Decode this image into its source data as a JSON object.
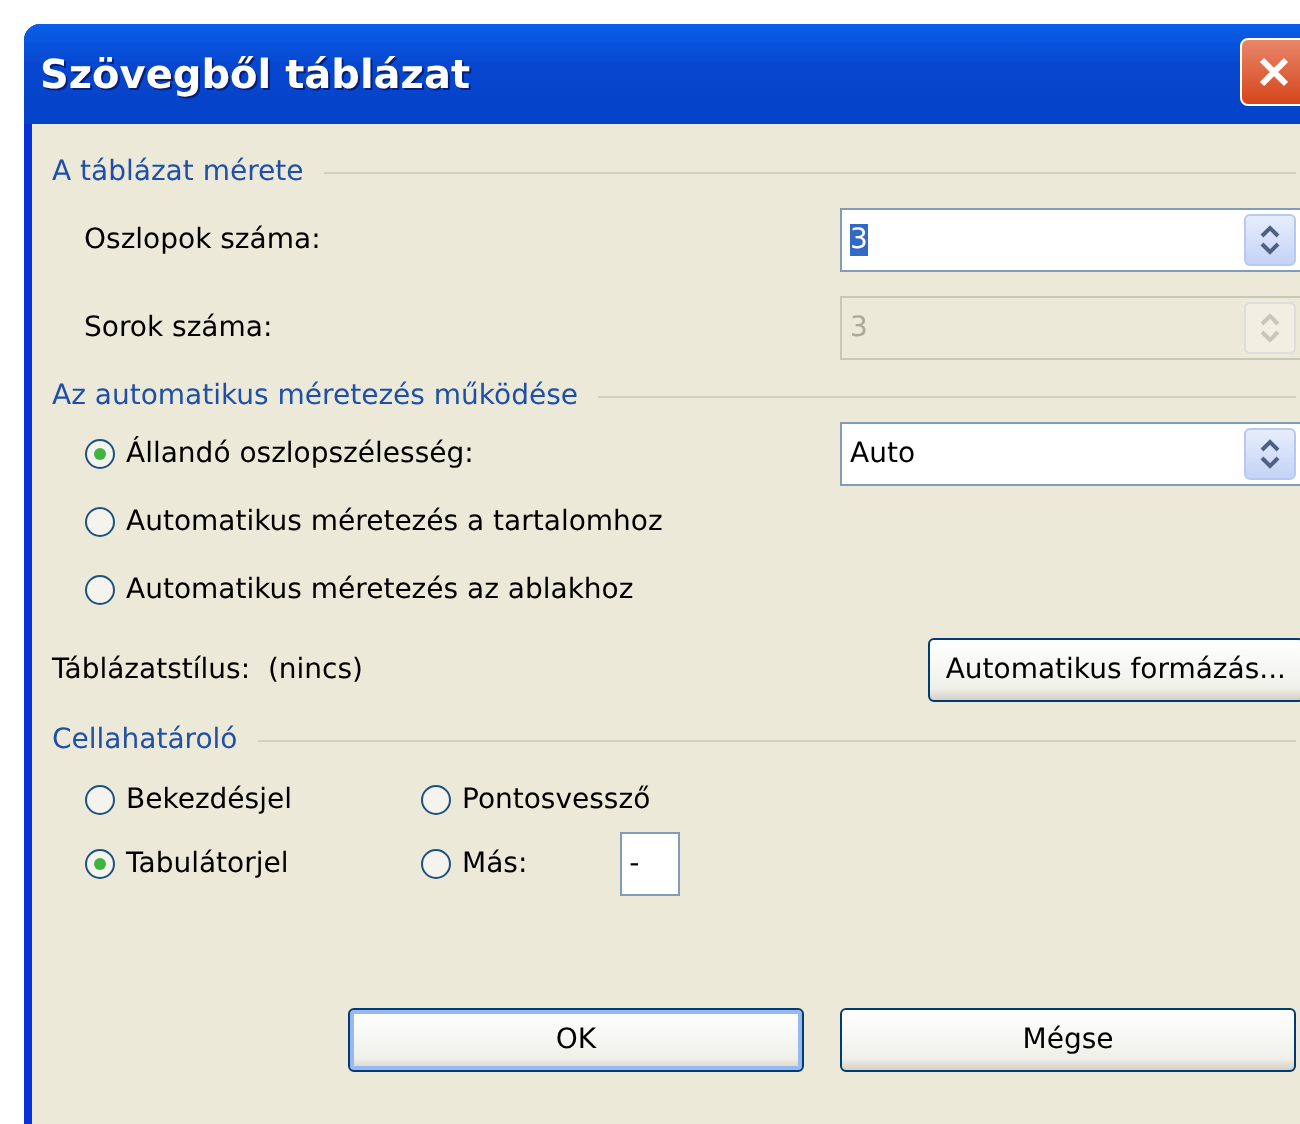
{
  "window": {
    "title": "Szövegből táblázat"
  },
  "size_group": {
    "title": "A táblázat mérete",
    "fields": [
      {
        "label": "Oszlopok száma:",
        "value": "3",
        "disabled": false,
        "value_highlighted": true
      },
      {
        "label": "Sorok száma:",
        "value": "3",
        "disabled": true,
        "value_highlighted": false
      }
    ]
  },
  "autofit_group": {
    "title": "Az automatikus méretezés működése",
    "options": [
      {
        "label": "Állandó oszlopszélesség:",
        "selected": true,
        "spin_value": "Auto"
      },
      {
        "label": "Automatikus méretezés a tartalomhoz",
        "selected": false
      },
      {
        "label": "Automatikus méretezés az ablakhoz",
        "selected": false
      }
    ]
  },
  "table_style": {
    "label": "Táblázatstílus:",
    "value": "(nincs)",
    "button": {
      "label": "Automatikus formázás..."
    }
  },
  "separator_group": {
    "title": "Cellahatároló",
    "options": [
      {
        "label": "Bekezdésjel",
        "selected": false
      },
      {
        "label": "Pontosvessző",
        "selected": false
      },
      {
        "label": "Tabulátorjel",
        "selected": true
      },
      {
        "label": "Más:",
        "selected": false,
        "other_value": "-"
      }
    ]
  },
  "buttons": [
    {
      "label": "OK",
      "default": true
    },
    {
      "label": "Mégse",
      "default": false
    }
  ]
}
